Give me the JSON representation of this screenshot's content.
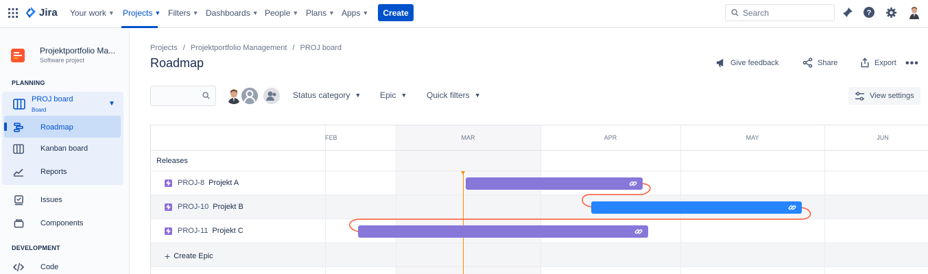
{
  "topnav": {
    "logo": "Jira",
    "items": [
      {
        "label": "Your work"
      },
      {
        "label": "Projects"
      },
      {
        "label": "Filters"
      },
      {
        "label": "Dashboards"
      },
      {
        "label": "People"
      },
      {
        "label": "Plans"
      },
      {
        "label": "Apps"
      }
    ],
    "create_label": "Create",
    "search_placeholder": "Search"
  },
  "sidebar": {
    "project_name": "Projektportfolio Ma...",
    "project_type": "Software project",
    "planning_header": "PLANNING",
    "board_title": "PROJ board",
    "board_sub": "Board",
    "items": [
      {
        "label": "Roadmap"
      },
      {
        "label": "Kanban board"
      },
      {
        "label": "Reports"
      },
      {
        "label": "Issues"
      },
      {
        "label": "Components"
      }
    ],
    "development_header": "DEVELOPMENT",
    "code_label": "Code"
  },
  "main": {
    "breadcrumb": [
      "Projects",
      "/",
      "Projektportfolio Management",
      "/",
      "PROJ board"
    ],
    "title": "Roadmap",
    "actions": {
      "feedback": "Give feedback",
      "share": "Share",
      "export": "Export"
    },
    "filters": {
      "status_category": "Status category",
      "epic": "Epic",
      "quick_filters": "Quick filters",
      "view_settings": "View settings"
    }
  },
  "roadmap": {
    "months": [
      "FEB",
      "MAR",
      "APR",
      "MAY",
      "JUN"
    ],
    "releases_label": "Releases",
    "epics": [
      {
        "key": "PROJ-8",
        "name": "Projekt A",
        "color": "#8777d9"
      },
      {
        "key": "PROJ-10",
        "name": "Projekt B",
        "color": "#2684ff"
      },
      {
        "key": "PROJ-11",
        "name": "Projekt C",
        "color": "#8777d9"
      }
    ],
    "create_epic": "Create Epic",
    "dependency_color": "#ff5630",
    "today_color": "#ff8b00"
  }
}
